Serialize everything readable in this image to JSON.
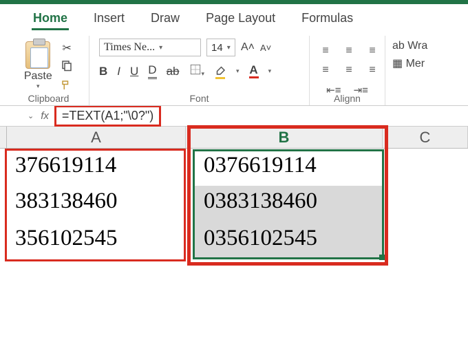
{
  "tabs": {
    "home": "Home",
    "insert": "Insert",
    "draw": "Draw",
    "page_layout": "Page Layout",
    "formulas": "Formulas"
  },
  "clipboard": {
    "paste": "Paste",
    "label": "Clipboard"
  },
  "font": {
    "name": "Times Ne...",
    "size": "14",
    "grow": "A˄",
    "shrink": "A˅",
    "bold": "B",
    "italic": "I",
    "underline": "U",
    "dunder": "D",
    "strike": "ab",
    "label": "Font"
  },
  "align": {
    "label": "Alignn",
    "wrap": "ab Wra",
    "merge": "▦ Mer"
  },
  "formula_bar": {
    "fx": "fx",
    "value": "=TEXT(A1;\"\\0?\")"
  },
  "columns": {
    "A": "A",
    "B": "B",
    "C": "C"
  },
  "cells": {
    "A1": "376619114",
    "A2": "383138460",
    "A3": "356102545",
    "B1": "0376619114",
    "B2": "0383138460",
    "B3": "0356102545"
  },
  "chart_data": {
    "type": "table",
    "title": "Worksheet cells",
    "columns": [
      "A",
      "B"
    ],
    "rows": [
      [
        "376619114",
        "0376619114"
      ],
      [
        "383138460",
        "0383138460"
      ],
      [
        "356102545",
        "0356102545"
      ]
    ]
  }
}
